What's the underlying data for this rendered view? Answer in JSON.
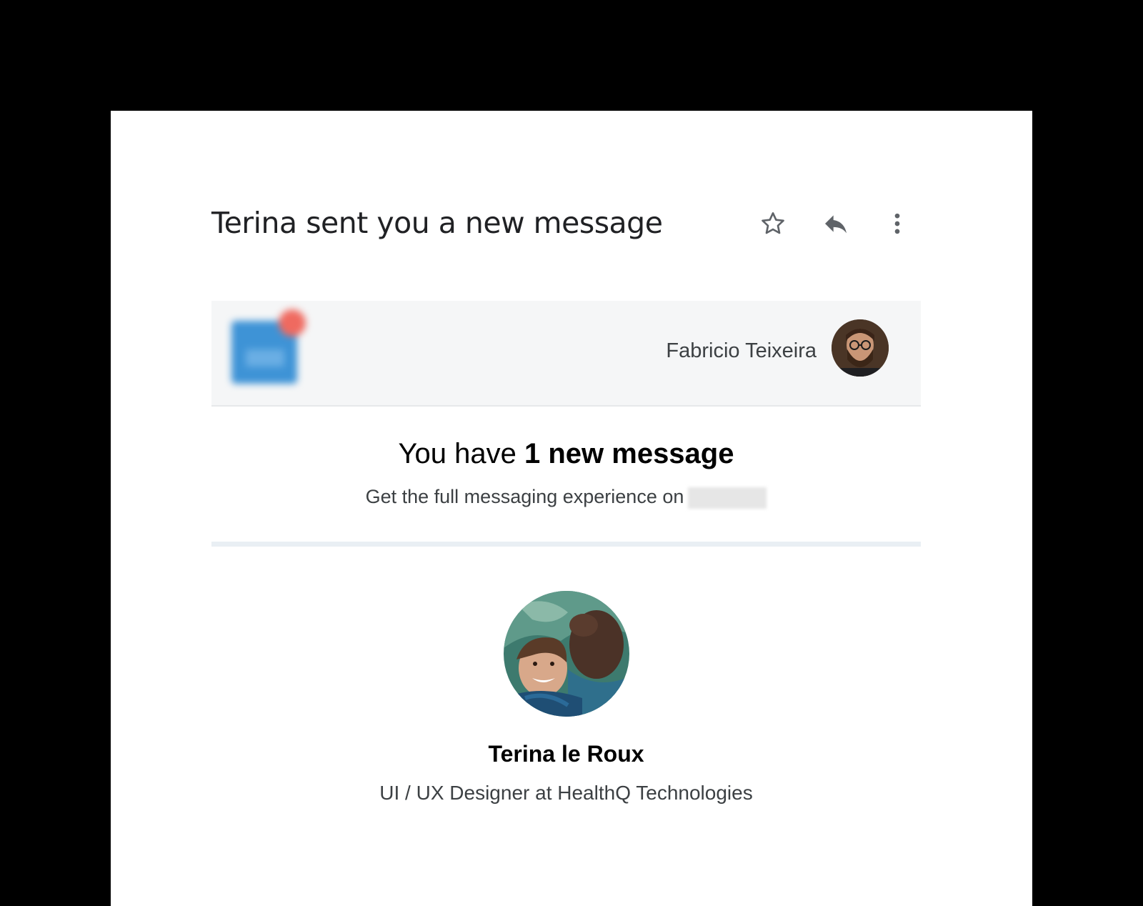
{
  "email": {
    "subject": "Terina sent you a new message",
    "actions": {
      "star_icon": "star-icon",
      "reply_icon": "reply-icon",
      "more_icon": "more-vertical-icon"
    }
  },
  "header": {
    "logo_icon": "app-logo-blurred",
    "recipient_name": "Fabricio Teixeira"
  },
  "body": {
    "headline_prefix": "You have ",
    "headline_bold": "1 new message",
    "subline": "Get the full messaging experience on"
  },
  "sender": {
    "name": "Terina le Roux",
    "title": "UI / UX Designer at HealthQ Technologies"
  },
  "colors": {
    "background": "#000000",
    "card": "#ffffff",
    "header_bg": "#f5f6f7",
    "logo_blue": "#3e93d6",
    "badge_red": "#ef6a60",
    "text_primary": "#202124",
    "text_secondary": "#3c4043"
  }
}
